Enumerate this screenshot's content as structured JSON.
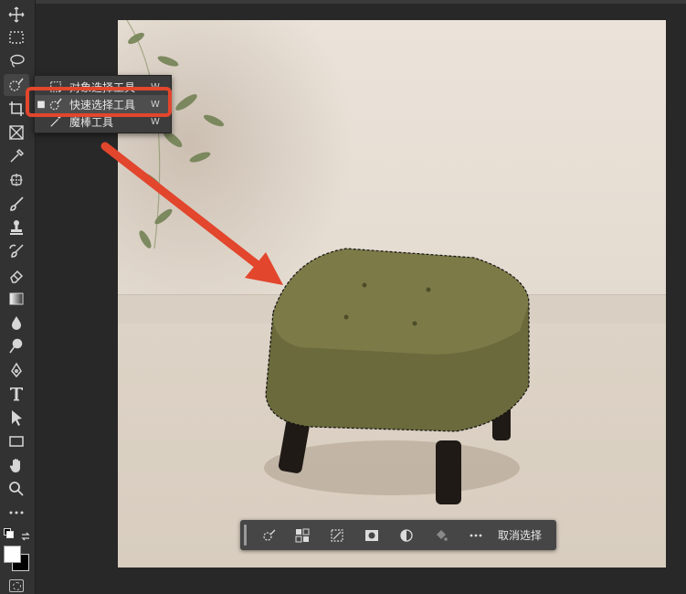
{
  "tool_popup": {
    "items": [
      {
        "label": "对象选择工具",
        "shortcut": "W"
      },
      {
        "label": "快速选择工具",
        "shortcut": "W",
        "selected": true
      },
      {
        "label": "魔棒工具",
        "shortcut": "W"
      }
    ]
  },
  "contextual_task_bar": {
    "deselect_label": "取消选择"
  },
  "colors": {
    "annotation": "#e2462d",
    "panel_bg": "#323232",
    "workspace_bg": "#282828"
  },
  "icons": {
    "toolbar": [
      "move-icon",
      "marquee-icon",
      "lasso-icon",
      "quick-selection-icon",
      "crop-icon",
      "frame-icon",
      "eyedropper-icon",
      "healing-icon",
      "brush-icon",
      "stamp-icon",
      "history-brush-icon",
      "eraser-icon",
      "gradient-icon",
      "blur-icon",
      "dodge-icon",
      "pen-icon",
      "type-icon",
      "path-selection-icon",
      "rectangle-icon",
      "hand-icon",
      "zoom-icon",
      "more-tools-icon"
    ]
  }
}
